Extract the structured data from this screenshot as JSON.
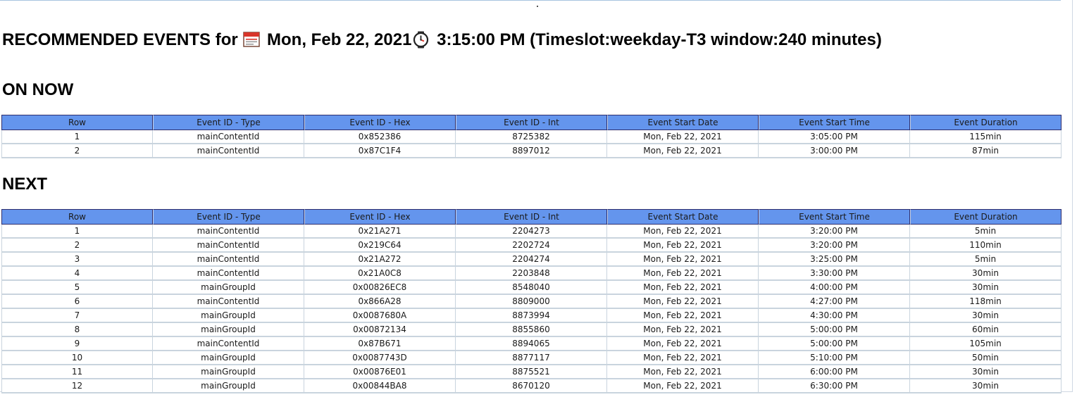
{
  "heading": {
    "prefix": "RECOMMENDED EVENTS for",
    "date": "Mon, Feb 22, 2021",
    "time": "3:15:00 PM",
    "suffix": "(Timeslot:weekday-T3 window:240 minutes)",
    "calendar_icon": "calendar-icon",
    "clock_icon": "clock-icon"
  },
  "columns": [
    "Row",
    "Event ID - Type",
    "Event ID - Hex",
    "Event ID - Int",
    "Event Start Date",
    "Event Start Time",
    "Event Duration"
  ],
  "on_now": {
    "title": "ON NOW",
    "rows": [
      [
        "1",
        "mainContentId",
        "0x852386",
        "8725382",
        "Mon, Feb 22, 2021",
        "3:05:00 PM",
        "115min"
      ],
      [
        "2",
        "mainContentId",
        "0x87C1F4",
        "8897012",
        "Mon, Feb 22, 2021",
        "3:00:00 PM",
        "87min"
      ]
    ]
  },
  "next": {
    "title": "NEXT",
    "rows": [
      [
        "1",
        "mainContentId",
        "0x21A271",
        "2204273",
        "Mon, Feb 22, 2021",
        "3:20:00 PM",
        "5min"
      ],
      [
        "2",
        "mainContentId",
        "0x219C64",
        "2202724",
        "Mon, Feb 22, 2021",
        "3:20:00 PM",
        "110min"
      ],
      [
        "3",
        "mainContentId",
        "0x21A272",
        "2204274",
        "Mon, Feb 22, 2021",
        "3:25:00 PM",
        "5min"
      ],
      [
        "4",
        "mainContentId",
        "0x21A0C8",
        "2203848",
        "Mon, Feb 22, 2021",
        "3:30:00 PM",
        "30min"
      ],
      [
        "5",
        "mainGroupId",
        "0x00826EC8",
        "8548040",
        "Mon, Feb 22, 2021",
        "4:00:00 PM",
        "30min"
      ],
      [
        "6",
        "mainContentId",
        "0x866A28",
        "8809000",
        "Mon, Feb 22, 2021",
        "4:27:00 PM",
        "118min"
      ],
      [
        "7",
        "mainGroupId",
        "0x0087680A",
        "8873994",
        "Mon, Feb 22, 2021",
        "4:30:00 PM",
        "30min"
      ],
      [
        "8",
        "mainGroupId",
        "0x00872134",
        "8855860",
        "Mon, Feb 22, 2021",
        "5:00:00 PM",
        "60min"
      ],
      [
        "9",
        "mainContentId",
        "0x87B671",
        "8894065",
        "Mon, Feb 22, 2021",
        "5:00:00 PM",
        "105min"
      ],
      [
        "10",
        "mainGroupId",
        "0x0087743D",
        "8877117",
        "Mon, Feb 22, 2021",
        "5:10:00 PM",
        "50min"
      ],
      [
        "11",
        "mainGroupId",
        "0x00876E01",
        "8875521",
        "Mon, Feb 22, 2021",
        "6:00:00 PM",
        "30min"
      ],
      [
        "12",
        "mainGroupId",
        "0x00844BA8",
        "8670120",
        "Mon, Feb 22, 2021",
        "6:30:00 PM",
        "30min"
      ]
    ]
  }
}
